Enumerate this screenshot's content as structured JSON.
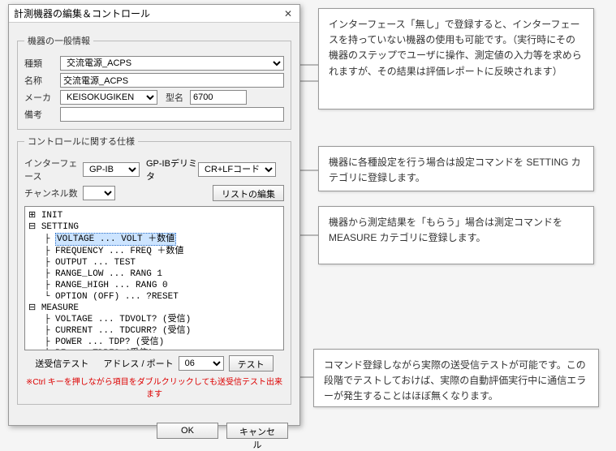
{
  "dialog": {
    "title": "計測機器の編集＆コントロール"
  },
  "group_general": {
    "legend": "機器の一般情報",
    "type_label": "種類",
    "type_value": "交流電源_ACPS",
    "name_label": "名称",
    "name_value": "交流電源_ACPS",
    "maker_label": "メーカ",
    "maker_value": "KEISOKUGIKEN",
    "model_label": "型名",
    "model_value": "6700",
    "note_label": "備考",
    "note_value": ""
  },
  "group_control": {
    "legend": "コントロールに関する仕様",
    "interface_label": "インターフェース",
    "interface_value": "GP-IB",
    "gpib_delim_label": "GP-IBデリミタ",
    "gpib_delim_value": "CR+LFコード",
    "channel_label": "チャンネル数",
    "channel_value": "",
    "list_edit_btn": "リストの編集",
    "tree": {
      "n_init": "INIT",
      "n_setting": "SETTING",
      "sel": "VOLTAGE ... VOLT ＋数値",
      "s2": "FREQUENCY ... FREQ ＋数値",
      "s3": "OUTPUT ... TEST",
      "s4": "RANGE_LOW ... RANG 1",
      "s5": "RANGE_HIGH ... RANG 0",
      "s6": "OPTION (OFF) ... ?RESET",
      "n_measure": "MEASURE",
      "m1": "VOLTAGE ... TDVOLT? (受信)",
      "m2": "CURRENT ... TDCURR? (受信)",
      "m3": "POWER ... TDP? (受信)",
      "m4": "PF ... TDPF? (受信)"
    },
    "test_label": "送受信テスト",
    "addr_label": "アドレス / ポート",
    "addr_value": "06",
    "test_btn": "テスト",
    "hint": "※Ctrl キーを押しながら項目をダブルクリックしても送受信テスト出来ます"
  },
  "buttons": {
    "ok": "OK",
    "cancel": "キャンセル"
  },
  "callouts": {
    "c1": "インターフェース「無し」で登録すると、インターフェースを持っていない機器の使用も可能です。（実行時にその機器のステップでユーザに操作、測定値の入力等を求められますが、その結果は評価レポートに反映されます）",
    "c2": "機器に各種設定を行う場合は設定コマンドを SETTING カテゴリに登録します。",
    "c3": "機器から測定結果を「もらう」場合は測定コマンドを MEASURE カテゴリに登録します。",
    "c4": "コマンド登録しながら実際の送受信テストが可能です。この段階でテストしておけば、実際の自動評価実行中に通信エラーが発生することはほぼ無くなります。"
  }
}
